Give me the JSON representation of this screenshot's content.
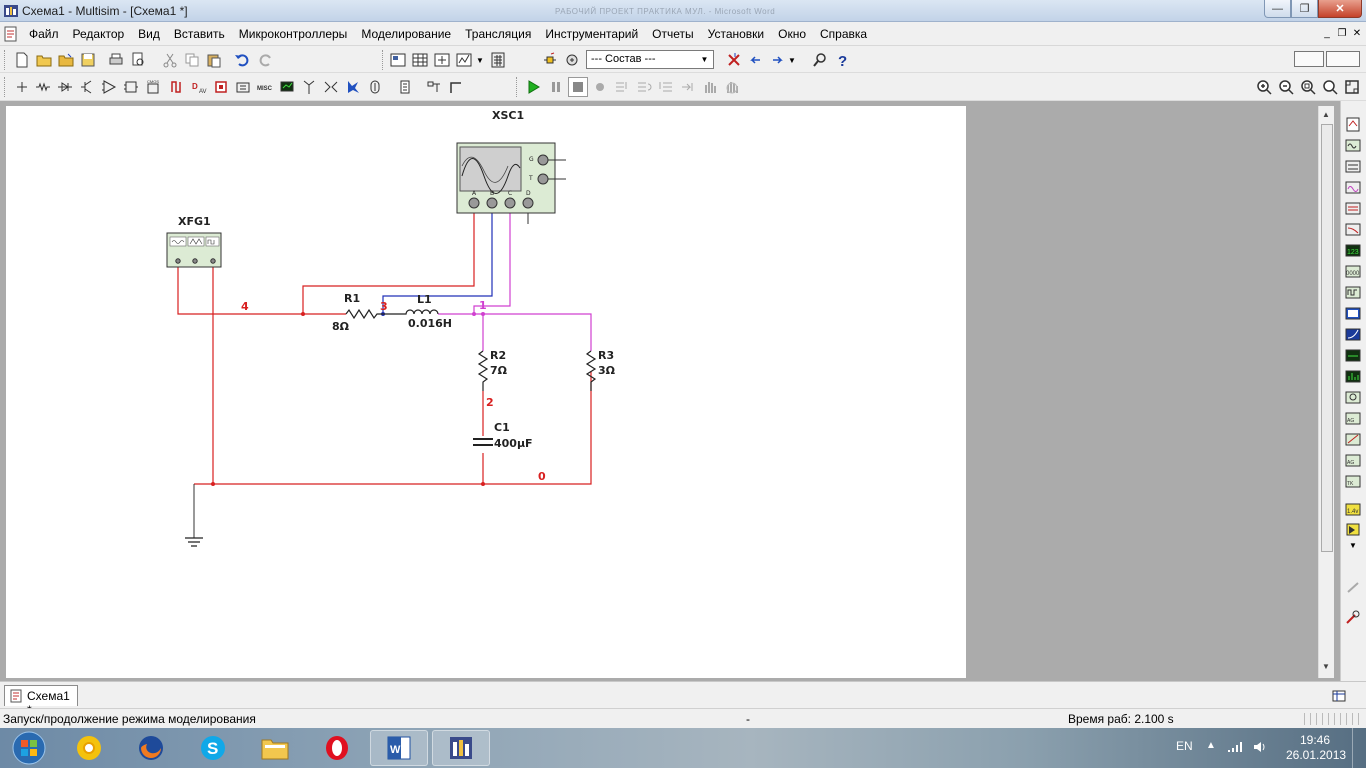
{
  "window": {
    "title": "Схема1 - Multisim - [Схема1 *]",
    "faded_title": "РАБОЧИЙ ПРОЕКТ ПРАКТИКА МУЛ. - Microsoft Word"
  },
  "menu": {
    "items": [
      "Файл",
      "Редактор",
      "Вид",
      "Вставить",
      "Микроконтроллеры",
      "Моделирование",
      "Трансляция",
      "Инструментарий",
      "Отчеты",
      "Установки",
      "Окно",
      "Справка"
    ]
  },
  "toolbar": {
    "combo_value": "--- Состав ---"
  },
  "schematic": {
    "instruments": {
      "oscilloscope": "XSC1",
      "generator": "XFG1",
      "osc_channel_labels": [
        "A",
        "B",
        "C",
        "D"
      ],
      "osc_side_labels": [
        "G",
        "T"
      ]
    },
    "components": {
      "R1": {
        "name": "R1",
        "value": "8Ω"
      },
      "L1": {
        "name": "L1",
        "value": "0.016H"
      },
      "R2": {
        "name": "R2",
        "value": "7Ω"
      },
      "R3": {
        "name": "R3",
        "value": "3Ω"
      },
      "C1": {
        "name": "C1",
        "value": "400µF"
      }
    },
    "nets": {
      "n4": "4",
      "n3": "3",
      "n1": "1",
      "n2": "2",
      "n0": "0"
    },
    "wire_colors": {
      "red": "#d82020",
      "blue": "#2030b8",
      "magenta": "#d040d0",
      "ground": "#333333"
    }
  },
  "tabs": [
    {
      "label": "Схема1 *"
    }
  ],
  "status": {
    "message": "Запуск/продолжение режима моделирования",
    "middle": "-",
    "runtime": "Время раб: 2.100 s"
  },
  "taskbar": {
    "lang": "EN",
    "time": "19:46",
    "date": "26.01.2013"
  }
}
